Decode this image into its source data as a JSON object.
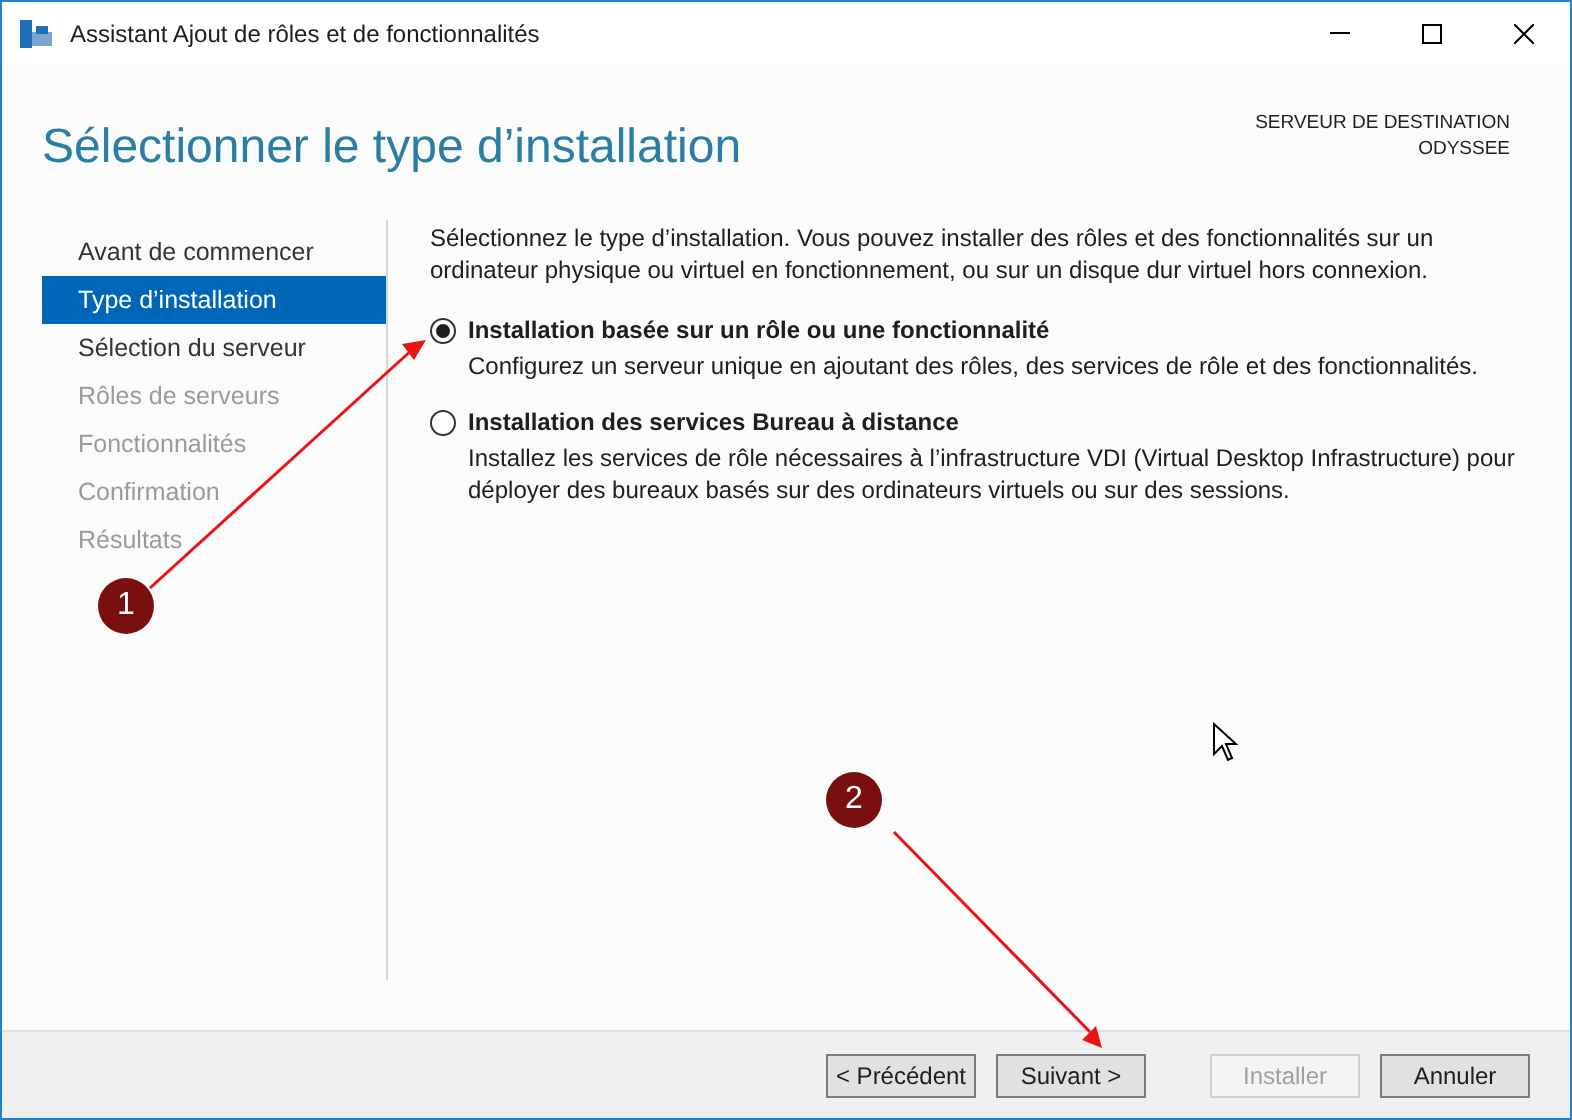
{
  "window": {
    "title": "Assistant Ajout de rôles et de fonctionnalités"
  },
  "header": {
    "title": "Sélectionner le type d’installation",
    "destination_label": "SERVEUR DE DESTINATION",
    "destination_server": "ODYSSEE"
  },
  "sidebar": {
    "items": [
      {
        "label": "Avant de commencer",
        "selected": false,
        "disabled": false
      },
      {
        "label": "Type d’installation",
        "selected": true,
        "disabled": false
      },
      {
        "label": "Sélection du serveur",
        "selected": false,
        "disabled": false
      },
      {
        "label": "Rôles de serveurs",
        "selected": false,
        "disabled": true
      },
      {
        "label": "Fonctionnalités",
        "selected": false,
        "disabled": true
      },
      {
        "label": "Confirmation",
        "selected": false,
        "disabled": true
      },
      {
        "label": "Résultats",
        "selected": false,
        "disabled": true
      }
    ]
  },
  "content": {
    "intro": "Sélectionnez le type d’installation. Vous pouvez installer des rôles et des fonctionnalités sur un ordinateur physique ou virtuel en fonctionnement, ou sur un disque dur virtuel hors connexion.",
    "options": [
      {
        "label": "Installation basée sur un rôle ou une fonctionnalité",
        "description": "Configurez un serveur unique en ajoutant des rôles, des services de rôle et des fonctionnalités.",
        "selected": true
      },
      {
        "label": "Installation des services Bureau à distance",
        "description": "Installez les services de rôle nécessaires à l’infrastructure VDI (Virtual Desktop Infrastructure) pour déployer des bureaux basés sur des ordinateurs virtuels ou sur des sessions.",
        "selected": false
      }
    ]
  },
  "buttons": [
    {
      "label": "< Précédent",
      "disabled": false
    },
    {
      "label": "Suivant >",
      "disabled": false
    },
    {
      "label": "Installer",
      "disabled": true
    },
    {
      "label": "Annuler",
      "disabled": false
    }
  ],
  "annotations": [
    {
      "number": "1"
    },
    {
      "number": "2"
    }
  ]
}
